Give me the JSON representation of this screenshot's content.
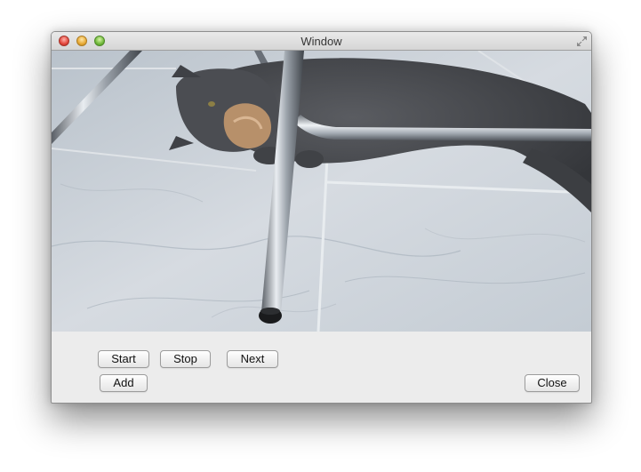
{
  "window": {
    "title": "Window"
  },
  "controls": {
    "start_label": "Start",
    "stop_label": "Stop",
    "next_label": "Next",
    "add_label": "Add",
    "close_label": "Close"
  },
  "colors": {
    "close_light": "#e3453b",
    "minimize_light": "#e7a934",
    "zoom_light": "#70b83a",
    "window_background": "#ececec"
  },
  "icons": {
    "fullscreen": "fullscreen-arrows-icon"
  }
}
